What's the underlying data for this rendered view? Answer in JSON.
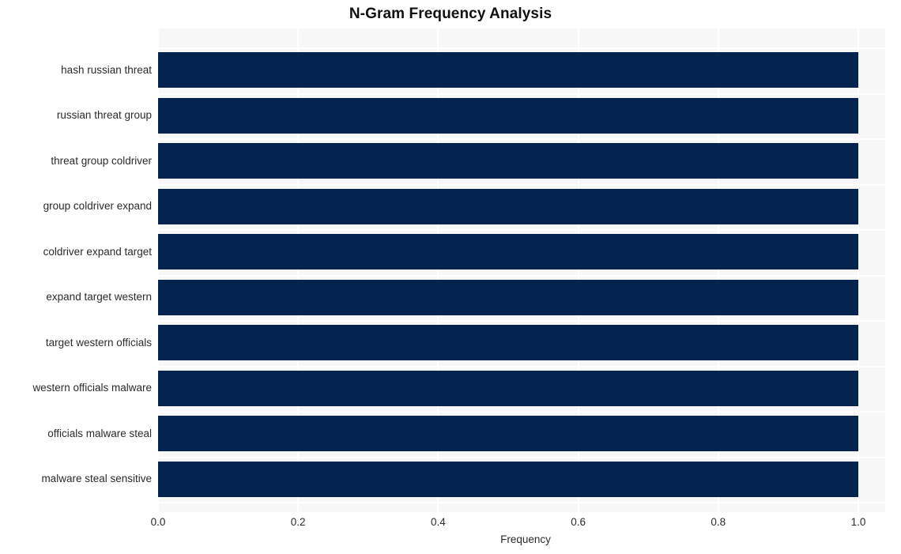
{
  "chart_data": {
    "type": "bar",
    "orientation": "horizontal",
    "title": "N-Gram Frequency Analysis",
    "xlabel": "Frequency",
    "ylabel": "",
    "categories": [
      "hash russian threat",
      "russian threat group",
      "threat group coldriver",
      "group coldriver expand",
      "coldriver expand target",
      "expand target western",
      "target western officials",
      "western officials malware",
      "officials malware steal",
      "malware steal sensitive"
    ],
    "values": [
      1.0,
      1.0,
      1.0,
      1.0,
      1.0,
      1.0,
      1.0,
      1.0,
      1.0,
      1.0
    ],
    "xlim": [
      0.0,
      1.0
    ],
    "xticks": [
      "0.0",
      "0.2",
      "0.4",
      "0.6",
      "0.8",
      "1.0"
    ],
    "xtick_values": [
      0.0,
      0.2,
      0.4,
      0.6,
      0.8,
      1.0
    ],
    "grid": true,
    "legend": null,
    "bar_color": "#04244f",
    "plot_background": "#f7f7f8",
    "figure_background": "#ffffff",
    "text_color": "#2b2b2b",
    "title_color": "#111111"
  }
}
